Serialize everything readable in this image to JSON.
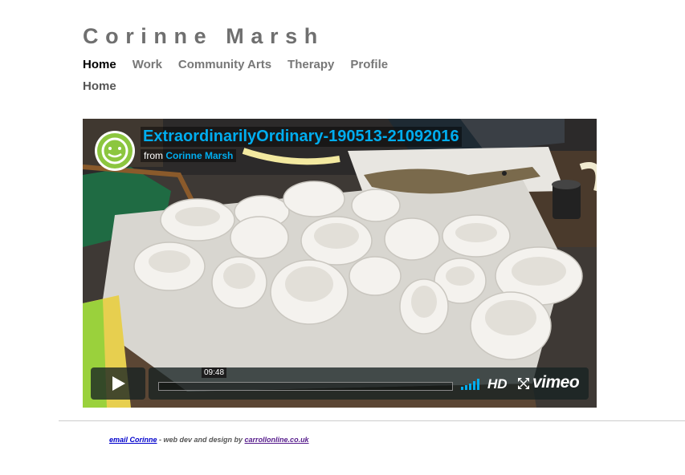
{
  "site": {
    "title": "Corinne Marsh"
  },
  "nav": {
    "items": [
      "Home",
      "Work",
      "Community Arts",
      "Therapy",
      "Profile"
    ],
    "active": "Home"
  },
  "breadcrumb": "Home",
  "video": {
    "title": "ExtraordinarilyOrdinary-190513-21092016",
    "from_label": "from",
    "author": "Corinne Marsh",
    "duration": "09:48",
    "progress_fraction": 0,
    "hd_label": "HD",
    "brand": "vimeo",
    "accent_color": "#00adef"
  },
  "footer": {
    "email_link": "email Corinne",
    "credit_text": " - web dev and design by ",
    "designer_link": "carrollonline.co.uk"
  }
}
